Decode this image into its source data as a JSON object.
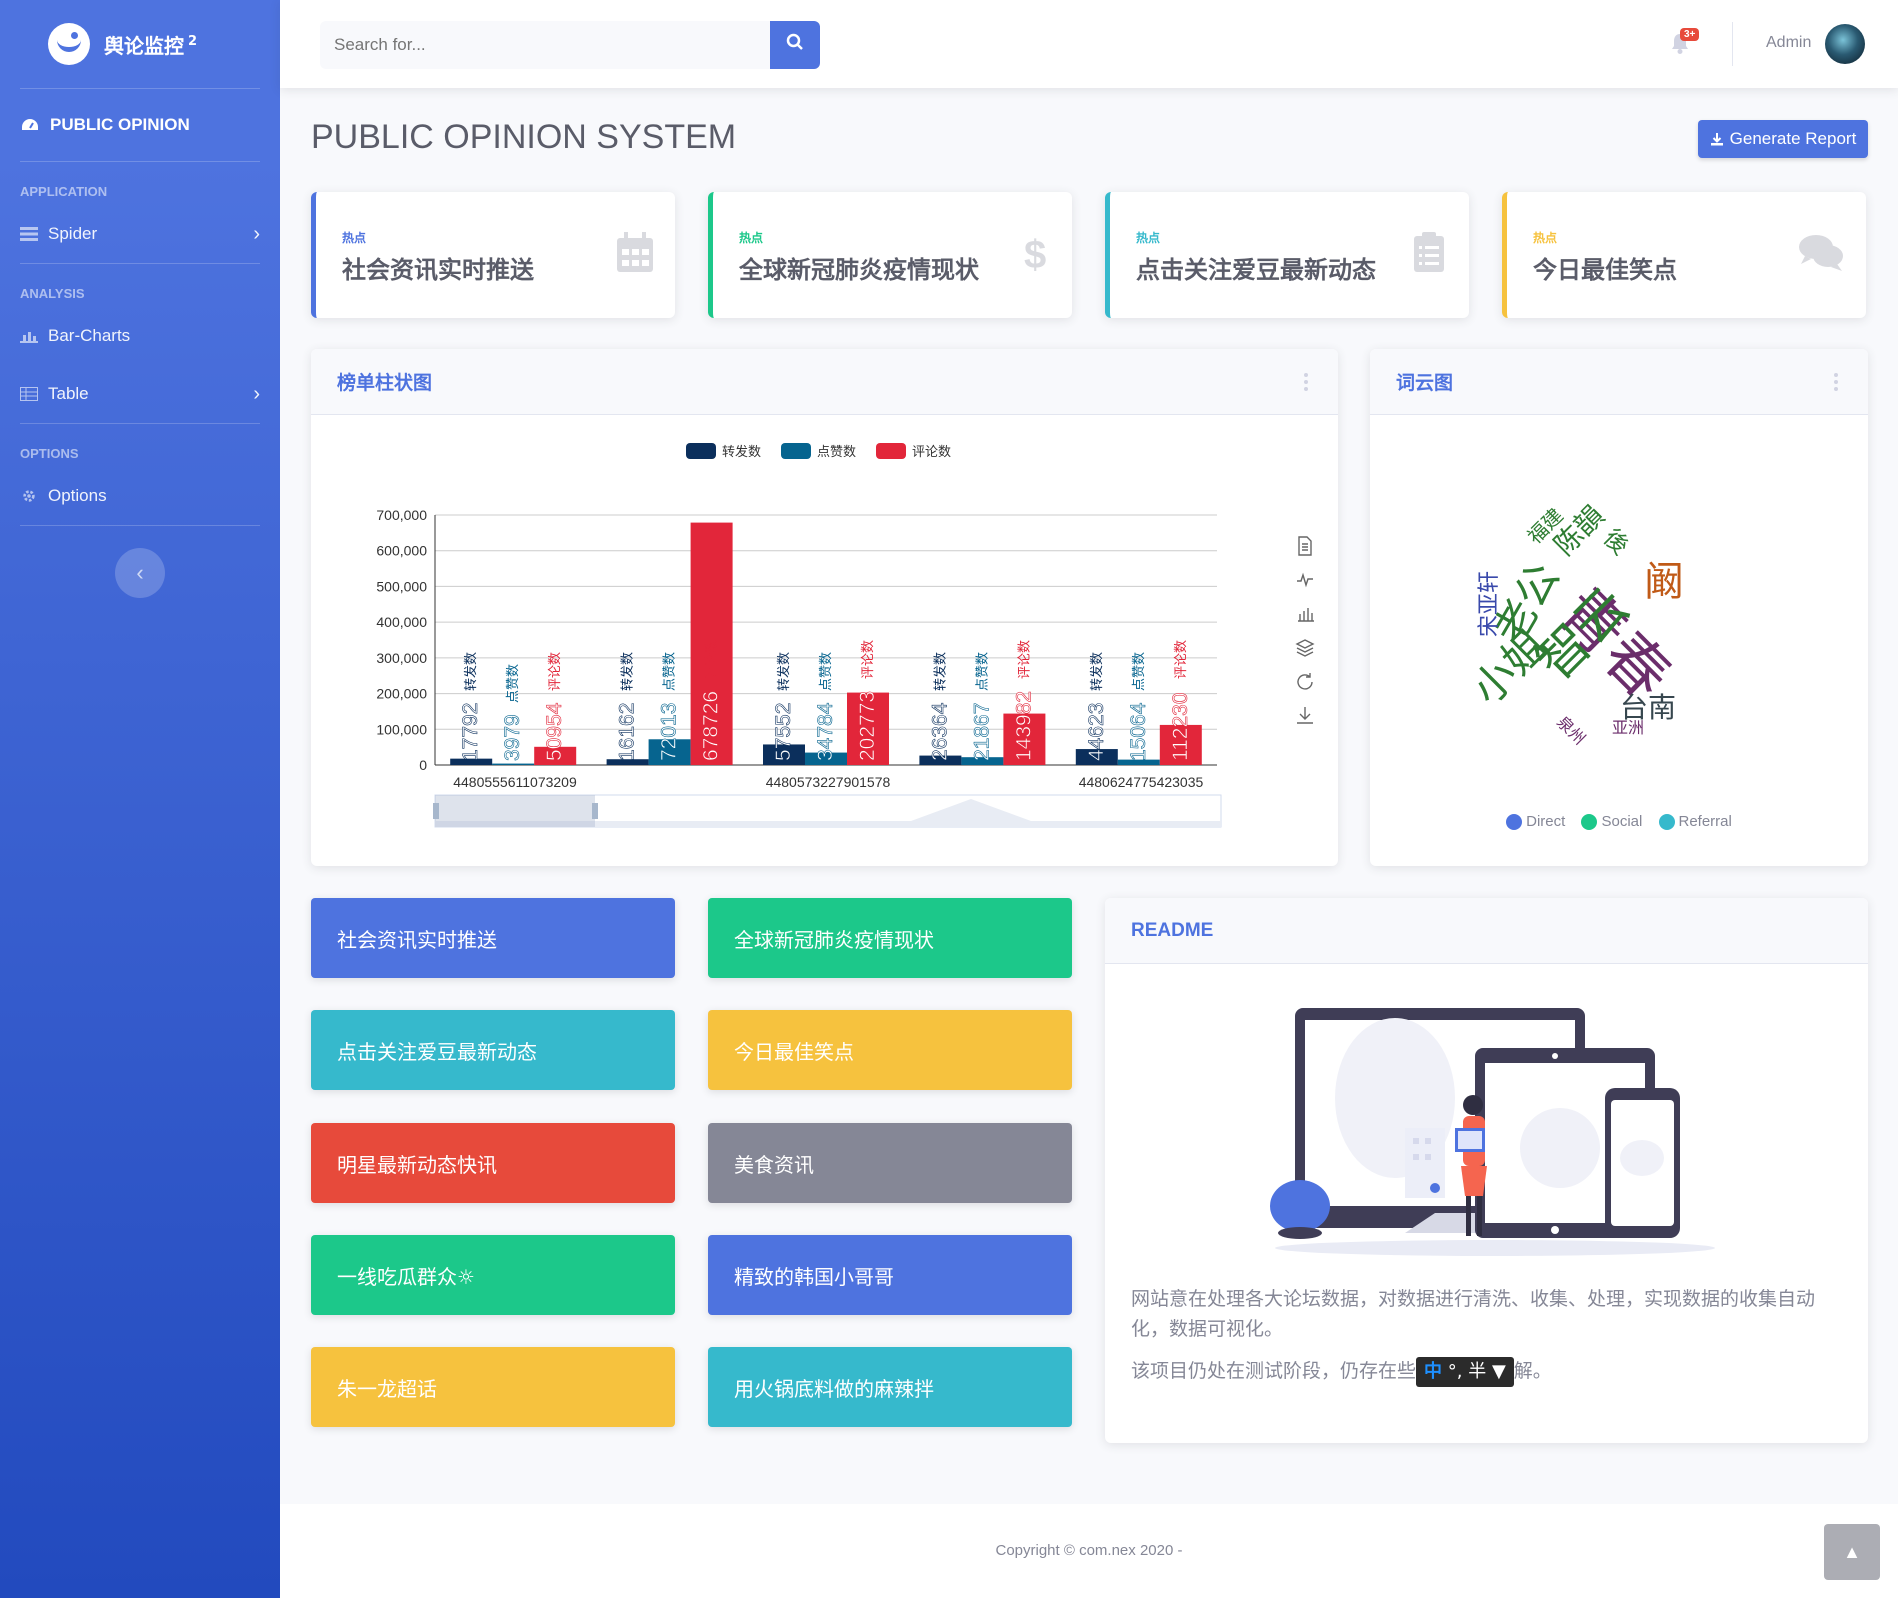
{
  "brand": {
    "name": "舆论监控",
    "sup": "2"
  },
  "sidebar": {
    "active": "PUBLIC OPINION",
    "sections": [
      {
        "heading": "APPLICATION",
        "items": [
          {
            "label": "Spider",
            "has_arrow": true,
            "icon": "list-icon"
          }
        ]
      },
      {
        "heading": "ANALYSIS",
        "items": [
          {
            "label": "Bar-Charts",
            "icon": "chart-icon"
          },
          {
            "label": "Table",
            "has_arrow": true,
            "icon": "table-icon"
          }
        ]
      },
      {
        "heading": "OPTIONS",
        "items": [
          {
            "label": "Options",
            "icon": "gear-icon"
          }
        ]
      }
    ]
  },
  "topbar": {
    "search_placeholder": "Search for...",
    "badge": "3+",
    "user": "Admin"
  },
  "page": {
    "title": "PUBLIC OPINION SYSTEM",
    "report_btn": "Generate Report"
  },
  "stats": [
    {
      "small": "热点",
      "title": "社会资讯实时推送",
      "color": "#4e73df",
      "icon": "calendar-icon"
    },
    {
      "small": "热点",
      "title": "全球新冠肺炎疫情现状",
      "color": "#1cc88a",
      "icon": "dollar-icon"
    },
    {
      "small": "热点",
      "title": "点击关注爱豆最新动态",
      "color": "#36b9cc",
      "icon": "clipboard-icon"
    },
    {
      "small": "热点",
      "title": "今日最佳笑点",
      "color": "#f6c23e",
      "icon": "comments-icon"
    }
  ],
  "bar_card": {
    "title": "榜单柱状图"
  },
  "cloud_card": {
    "title": "词云图",
    "legend": [
      {
        "label": "Direct",
        "color": "#4e73df"
      },
      {
        "label": "Social",
        "color": "#1cc88a"
      },
      {
        "label": "Referral",
        "color": "#36b9cc"
      }
    ]
  },
  "wordcloud": [
    {
      "text": "青春",
      "color": "#6b2d6b"
    },
    {
      "text": "智云",
      "color": "#2e7d32"
    },
    {
      "text": "老公",
      "color": "#2e7d32"
    },
    {
      "text": "小姐",
      "color": "#2e7d32"
    },
    {
      "text": "阚",
      "color": "#c05a17"
    },
    {
      "text": "陈韻",
      "color": "#2e7d32"
    },
    {
      "text": "福建",
      "color": "#2e7d32"
    },
    {
      "text": "宋亚轩",
      "color": "#3949ab"
    },
    {
      "text": "台南",
      "color": "#37474f"
    },
    {
      "text": "後",
      "color": "#2e7d32"
    },
    {
      "text": "泉州",
      "color": "#6b2d6b"
    },
    {
      "text": "亚洲",
      "color": "#6b2d6b"
    }
  ],
  "chart_data": {
    "type": "bar",
    "categories": [
      "4480555611073209",
      "4480573227901578",
      "4480573227901578b",
      "4480624775423035",
      "4480624775423035b"
    ],
    "x_labels": [
      "4480555611073209",
      "4480573227901578",
      "4480624775423035"
    ],
    "series": [
      {
        "name": "转发数",
        "color": "#0b2f5c",
        "values": [
          17792,
          16162,
          57552,
          26364,
          44623
        ]
      },
      {
        "name": "点赞数",
        "color": "#06648f",
        "values": [
          3979,
          72013,
          34784,
          21867,
          15064
        ]
      },
      {
        "name": "评论数",
        "color": "#e2263a",
        "values": [
          50954,
          678726,
          202773,
          143982,
          112230
        ]
      }
    ],
    "y_ticks": [
      "0",
      "100,000",
      "200,000",
      "300,000",
      "400,000",
      "500,000",
      "600,000",
      "700,000"
    ],
    "ylim": [
      0,
      700000
    ],
    "grid": true,
    "legend": "top",
    "toolbox": [
      "document-icon",
      "line-icon",
      "bar-icon",
      "stack-icon",
      "restore-icon",
      "download-icon"
    ]
  },
  "tiles": [
    {
      "label": "社会资讯实时推送",
      "color": "#4e73df"
    },
    {
      "label": "全球新冠肺炎疫情现状",
      "color": "#1cc88a"
    },
    {
      "label": "点击关注爱豆最新动态",
      "color": "#36b9cc"
    },
    {
      "label": "今日最佳笑点",
      "color": "#f6c23e"
    },
    {
      "label": "明星最新动态快讯",
      "color": "#e74a3b"
    },
    {
      "label": "美食资讯",
      "color": "#858796"
    },
    {
      "label": "一线吃瓜群众☼",
      "color": "#1cc88a"
    },
    {
      "label": "精致的韩国小哥哥",
      "color": "#4e73df"
    },
    {
      "label": "朱一龙超话",
      "color": "#f6c23e"
    },
    {
      "label": "用火锅底料做的麻辣拌",
      "color": "#36b9cc"
    }
  ],
  "readme": {
    "title": "README",
    "p1": "网站意在处理各大论坛数据，对数据进行清洗、收集、处理，实现数据的收集自动化，数据可视化。",
    "p2a": "该项目仍处在测试阶段，仍存在些",
    "p2b": "解。",
    "ime_zh": "中",
    "ime_rest": "°, 半"
  },
  "footer": {
    "copyright": "Copyright © com.nex 2020 -"
  }
}
